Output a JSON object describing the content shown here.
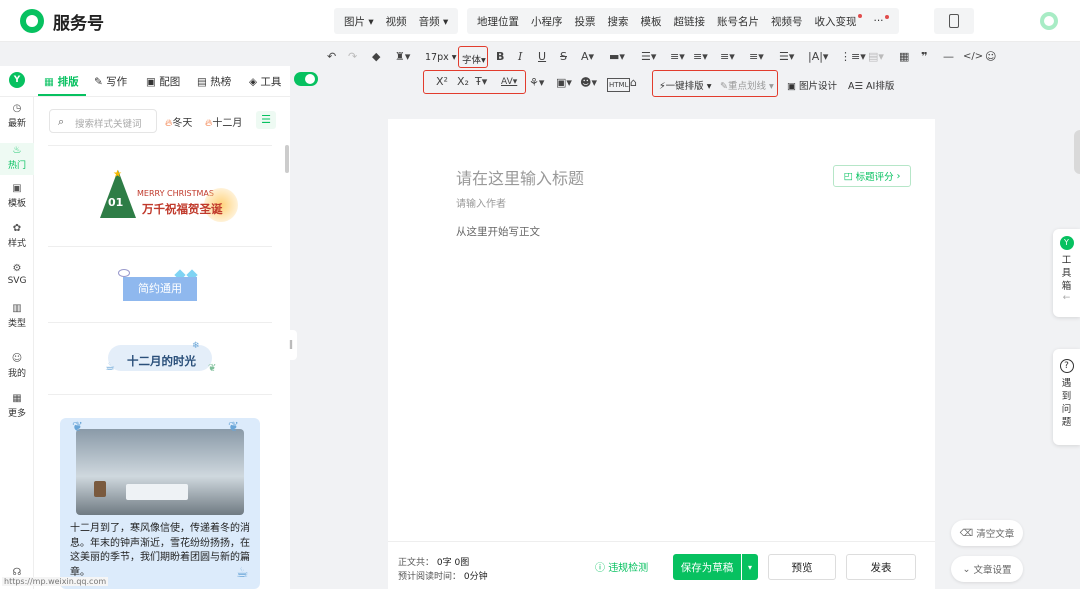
{
  "header": {
    "brand": "服务号",
    "nav_left": [
      "图片",
      "视频",
      "音频"
    ],
    "nav_right": [
      "地理位置",
      "小程序",
      "投票",
      "搜索",
      "模板",
      "超链接",
      "账号名片",
      "视频号",
      "收入变现"
    ],
    "more": "···"
  },
  "toolbar": {
    "font_size": "17px",
    "font_family": "字体",
    "one_click_layout": "一键排版",
    "highlight_line": "重点划线",
    "image_design": "图片设计",
    "ai_layout": "AI排版"
  },
  "sidebar": {
    "items": [
      {
        "label": "最新",
        "icon": "clock-icon"
      },
      {
        "label": "热门",
        "icon": "flame-icon"
      },
      {
        "label": "模板",
        "icon": "template-icon"
      },
      {
        "label": "样式",
        "icon": "style-icon"
      },
      {
        "label": "SVG",
        "icon": "svg-icon"
      },
      {
        "label": "类型",
        "icon": "type-icon"
      },
      {
        "label": "我的",
        "icon": "user-icon"
      },
      {
        "label": "更多",
        "icon": "grid-icon"
      }
    ],
    "status_url": "https://mp.weixin.qq.com"
  },
  "panel": {
    "tabs": [
      "排版",
      "写作",
      "配图",
      "热榜",
      "工具"
    ],
    "search_placeholder": "搜索样式关键词",
    "tags": [
      "冬天",
      "十二月"
    ],
    "cards": {
      "xmas_small": "MERRY CHRISTMAS",
      "xmas_number": "01",
      "xmas_title": "万千祝福贺圣诞",
      "simple": "简约通用",
      "december": "十二月的时光",
      "text_block": "十二月到了，寒风像信使，传递着冬的消息。年末的钟声渐近，雪花纷纷扬扬，在这美丽的季节，我们期盼着团圆与新的篇章。"
    }
  },
  "editor": {
    "title_placeholder": "请在这里输入标题",
    "author_placeholder": "请输入作者",
    "body_placeholder": "从这里开始写正文",
    "title_score": "标题评分"
  },
  "footer": {
    "word_count_label": "正文共：",
    "word_count_value": "0字 0图",
    "read_time_label": "预计阅读时间：",
    "read_time_value": "0分钟",
    "compliance": "违规检测",
    "save_draft": "保存为草稿",
    "preview": "预览",
    "publish": "发表"
  },
  "right": {
    "toolbox": "工具箱",
    "problem": "遇到问题",
    "clear_article": "清空文章",
    "article_settings": "文章设置"
  },
  "colors": {
    "accent": "#07c160",
    "highlight_box": "#e23c2d",
    "panel_bg": "#f1f2f4"
  }
}
